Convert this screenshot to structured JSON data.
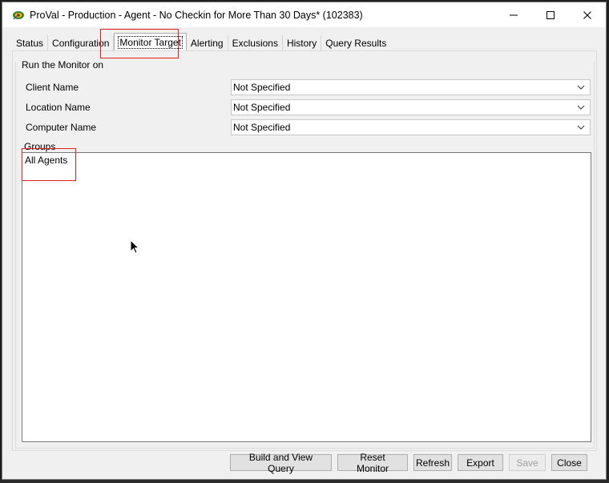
{
  "window": {
    "title": "ProVal - Production - Agent - No Checkin for More Than 30 Days* (102383)",
    "controls": {
      "minimize": "—",
      "maximize": "☐",
      "close": "✕"
    }
  },
  "tabs": [
    {
      "label": "Status"
    },
    {
      "label": "Configuration"
    },
    {
      "label": "Monitor Target",
      "active": true
    },
    {
      "label": "Alerting"
    },
    {
      "label": "Exclusions"
    },
    {
      "label": "History"
    },
    {
      "label": "Query Results"
    }
  ],
  "target": {
    "group_title": "Run the Monitor on",
    "client": {
      "label": "Client Name",
      "value": "Not Specified"
    },
    "location": {
      "label": "Location Name",
      "value": "Not Specified"
    },
    "computer": {
      "label": "Computer Name",
      "value": "Not Specified"
    },
    "groups_label": "Groups",
    "groups": [
      "All Agents"
    ]
  },
  "buttons": {
    "build_query": "Build and View Query",
    "reset_monitor": "Reset Monitor",
    "refresh": "Refresh",
    "export": "Export",
    "save": "Save",
    "close": "Close"
  },
  "colors": {
    "highlight": "#e02020",
    "window_bg": "#f0f0f0"
  }
}
